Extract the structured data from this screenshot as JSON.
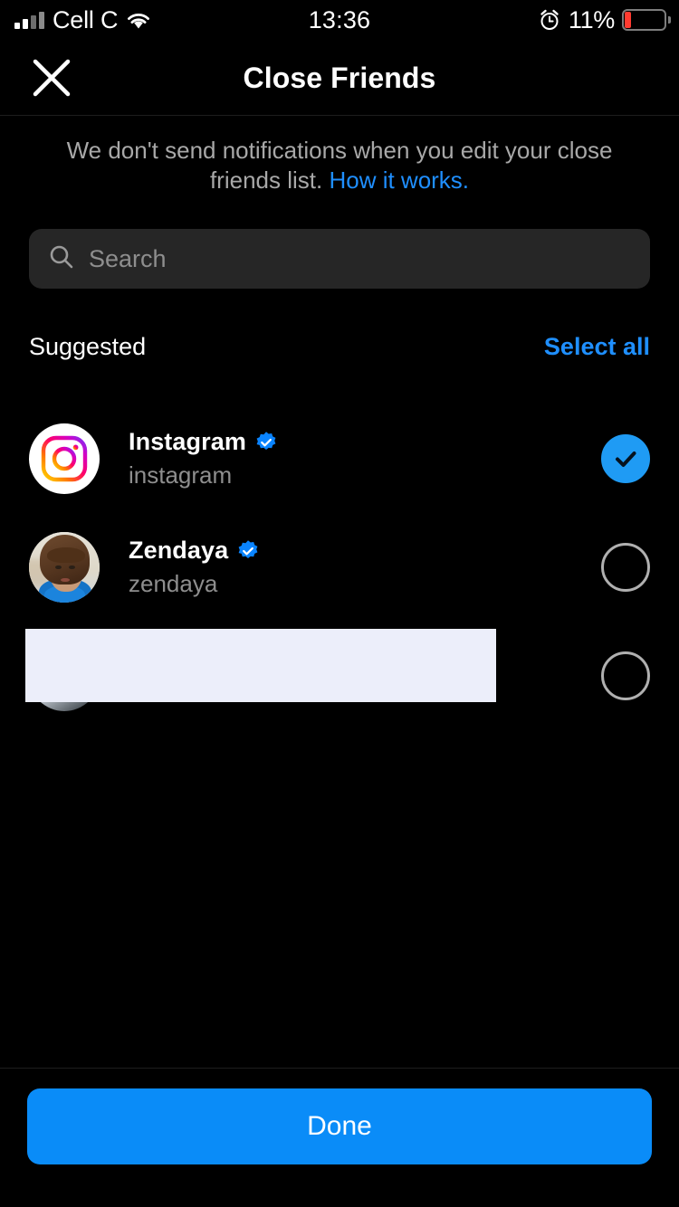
{
  "status_bar": {
    "carrier": "Cell C",
    "time": "13:36",
    "battery_percent": "11%",
    "signal_icon": "cellular-bars-icon",
    "wifi_icon": "wifi-icon",
    "alarm_icon": "alarm-clock-icon",
    "battery_icon": "battery-low-icon",
    "battery_low_color": "#ff3b30"
  },
  "header": {
    "title": "Close Friends",
    "close_icon": "close-icon"
  },
  "subtitle": {
    "text": "We don't send notifications when you edit your close friends list.",
    "link_text": "How it works."
  },
  "search": {
    "placeholder": "Search",
    "value": "",
    "icon": "search-icon"
  },
  "section": {
    "title": "Suggested",
    "select_all_label": "Select all"
  },
  "list": [
    {
      "fullname": "Instagram",
      "username": "instagram",
      "verified": true,
      "selected": true,
      "avatar_type": "instagram-logo"
    },
    {
      "fullname": "Zendaya",
      "username": "zendaya",
      "verified": true,
      "selected": false,
      "avatar_type": "photo"
    },
    {
      "fullname": "",
      "username": "",
      "verified": false,
      "selected": false,
      "avatar_type": "photo",
      "redacted": true
    }
  ],
  "footer": {
    "done_label": "Done"
  },
  "colors": {
    "accent_blue": "#0a8cf8",
    "link_blue": "#1f8fff",
    "selected_blue": "#1f9bf4",
    "background": "#000000",
    "search_field": "#262626",
    "secondary_text": "#8e8e8e",
    "redaction": "#eceefa"
  }
}
